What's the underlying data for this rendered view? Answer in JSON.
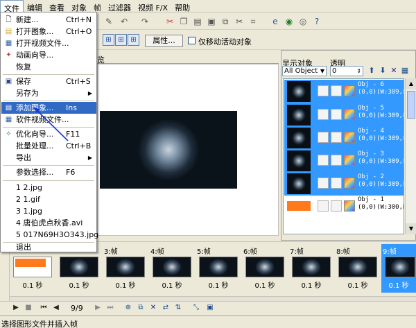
{
  "menubar": [
    "文件",
    "编辑",
    "查看",
    "对象",
    "帧",
    "过滤器",
    "视频 F/X",
    "帮助"
  ],
  "file_menu": {
    "items": [
      {
        "label": "新建...",
        "shortcut": "Ctrl+N",
        "icon": "new-file-icon"
      },
      {
        "label": "打开图象...",
        "shortcut": "Ctrl+O",
        "icon": "open-folder-icon"
      },
      {
        "label": "打开视频文件...",
        "shortcut": "",
        "icon": "open-video-icon"
      },
      {
        "label": "动画向导...",
        "shortcut": "",
        "icon": "wizard-icon"
      },
      {
        "label": "恢复",
        "shortcut": "",
        "icon": ""
      },
      {
        "label": "保存",
        "shortcut": "Ctrl+S",
        "icon": "save-icon"
      },
      {
        "label": "另存为",
        "shortcut": "",
        "icon": ""
      },
      {
        "label": "添加图象...",
        "shortcut": "Ins",
        "icon": "add-image-icon"
      },
      {
        "label": "软件视频文件...",
        "shortcut": "",
        "icon": "video-file-icon"
      },
      {
        "label": "优化向导...",
        "shortcut": "F11",
        "icon": "optimize-icon"
      },
      {
        "label": "批量处理...",
        "shortcut": "Ctrl+B",
        "icon": ""
      },
      {
        "label": "导出",
        "shortcut": "",
        "icon": ""
      },
      {
        "label": "参数选择...",
        "shortcut": "F6",
        "icon": ""
      },
      {
        "label": "1 2.jpg",
        "shortcut": "",
        "icon": ""
      },
      {
        "label": "2 1.gif",
        "shortcut": "",
        "icon": ""
      },
      {
        "label": "3 1.jpg",
        "shortcut": "",
        "icon": ""
      },
      {
        "label": "4 唐伯虎点秋香.avi",
        "shortcut": "",
        "icon": ""
      },
      {
        "label": "5 017N69H3O343.jpg",
        "shortcut": "",
        "icon": ""
      },
      {
        "label": "退出",
        "shortcut": "",
        "icon": ""
      }
    ]
  },
  "toolbar2": {
    "properties_button": "属性...",
    "move_active_label": "仅移动活动对象"
  },
  "main": {
    "tab_partial": "览"
  },
  "right_panel": {
    "display_label": "显示对象",
    "alpha_label": "透明",
    "display_value": "All Object",
    "alpha_value": "0",
    "objects": [
      {
        "name": "Obj - 6",
        "info": "(0,0)(W:309,H:"
      },
      {
        "name": "Obj - 5",
        "info": "(0,0)(W:309,H:"
      },
      {
        "name": "Obj - 4",
        "info": "(0,0)(W:309,H:"
      },
      {
        "name": "Obj - 3",
        "info": "(0,0)(W:309,H:"
      },
      {
        "name": "Obj - 2",
        "info": "(0,0)(W:309,H:"
      },
      {
        "name": "Obj - 1",
        "info": "(0,0)(W:300,H:"
      }
    ]
  },
  "timeline": {
    "frames": [
      {
        "label": "",
        "duration": "0.1 秒"
      },
      {
        "label": "",
        "duration": "0.1 秒"
      },
      {
        "label": "3:帧",
        "duration": "0.1 秒"
      },
      {
        "label": "4:帧",
        "duration": "0.1 秒"
      },
      {
        "label": "5:帧",
        "duration": "0.1 秒"
      },
      {
        "label": "6:帧",
        "duration": "0.1 秒"
      },
      {
        "label": "7:帧",
        "duration": "0.1 秒"
      },
      {
        "label": "8:帧",
        "duration": "0.1 秒"
      },
      {
        "label": "9:帧",
        "duration": "0.1 秒"
      }
    ],
    "counter": "9/9"
  },
  "status_text": "选择图形文件并插入帧",
  "colors": {
    "selection": "#3399ff",
    "menu_highlight": "#316ac5",
    "arrow": "#1a3ad4"
  }
}
